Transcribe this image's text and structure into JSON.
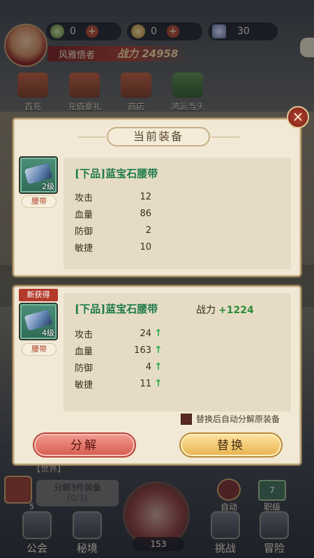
{
  "hud": {
    "resources": [
      {
        "value": "0",
        "icon": "jade-coin-icon"
      },
      {
        "value": "0",
        "icon": "gold-coin-icon"
      },
      {
        "value": "30",
        "icon": "crystal-icon"
      }
    ],
    "player_name": "风雅悟者",
    "power_label": "战力 24958",
    "quick_menu": [
      "首充",
      "充值豪礼",
      "商店",
      "鸿运当头"
    ],
    "world_chat": "【世界】",
    "task_title": "分解3件装备",
    "task_progress": "(0/3)",
    "left_count": "5",
    "stage_count": "153",
    "auto_label": "自动",
    "slot_label": "职级",
    "slot_badge": "7",
    "nav": [
      "公会",
      "秘境",
      "挑战",
      "冒险"
    ]
  },
  "modal": {
    "close_icon": "×",
    "current": {
      "title": "当前装备",
      "item_name": "[下品]蓝宝石腰带",
      "level": "2级",
      "slot": "腰带",
      "stats": [
        {
          "name": "攻击",
          "value": "12"
        },
        {
          "name": "血量",
          "value": "86"
        },
        {
          "name": "防御",
          "value": "2"
        },
        {
          "name": "敏捷",
          "value": "10"
        }
      ]
    },
    "new": {
      "tag": "新获得",
      "item_name": "[下品]蓝宝石腰带",
      "power_label": "战力",
      "power_delta": "+1224",
      "level": "4级",
      "slot": "腰带",
      "stats": [
        {
          "name": "攻击",
          "value": "24",
          "trend": "up"
        },
        {
          "name": "血量",
          "value": "163",
          "trend": "up"
        },
        {
          "name": "防御",
          "value": "4",
          "trend": "up"
        },
        {
          "name": "敏捷",
          "value": "11",
          "trend": "up"
        }
      ],
      "auto_decompose_label": "替换后自动分解原装备",
      "auto_decompose_checked": false,
      "decompose_button": "分解",
      "replace_button": "替换"
    }
  },
  "colors": {
    "item_quality": "#1e7a4a",
    "stat_up": "#2fae4a",
    "decompose": "#d65b4e",
    "replace": "#e6b24e"
  }
}
